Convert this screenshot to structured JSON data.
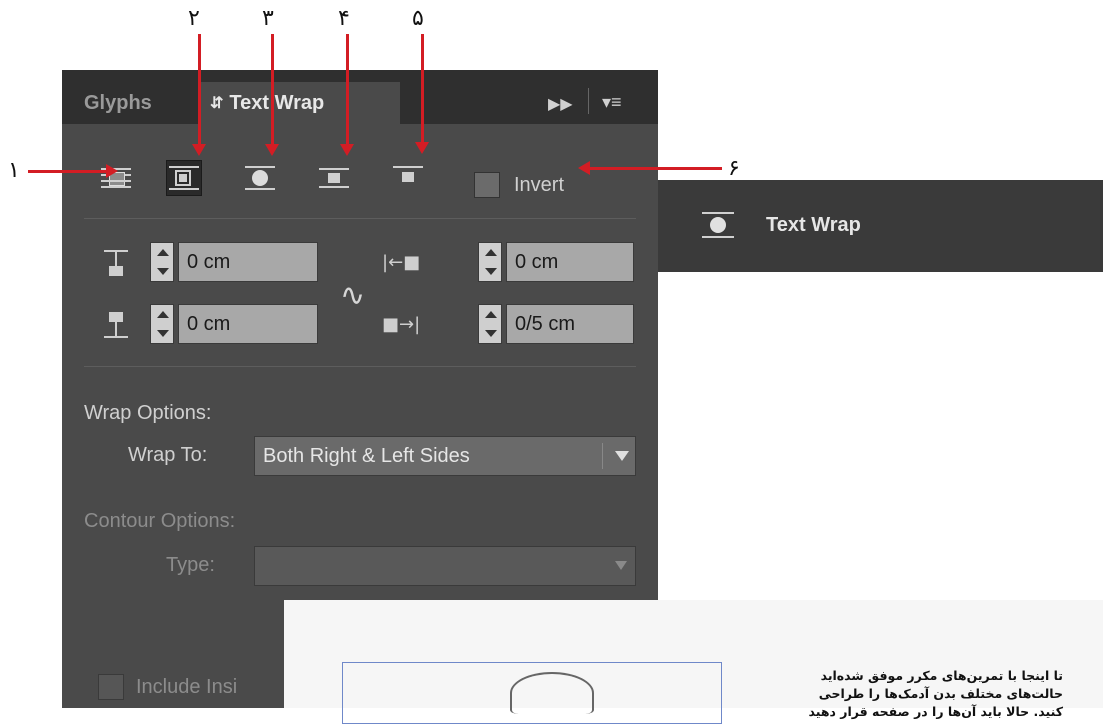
{
  "callouts": [
    "۱",
    "۲",
    "۳",
    "۴",
    "۵",
    "۶"
  ],
  "panel": {
    "tabs": [
      "Glyphs",
      "Text Wrap"
    ],
    "active_tab_icon": "up-down-chevron-icon",
    "tab_menu_icons": [
      "expand-arrows-icon",
      "panel-menu-icon"
    ],
    "wrap_buttons": [
      {
        "name": "no-text-wrap-icon"
      },
      {
        "name": "wrap-around-bounding-box-icon",
        "selected": true
      },
      {
        "name": "wrap-around-object-shape-icon"
      },
      {
        "name": "jump-object-icon"
      },
      {
        "name": "jump-to-next-column-icon"
      }
    ],
    "invert_label": "Invert",
    "offsets": {
      "top": "0 cm",
      "bottom": "0 cm",
      "left": "0 cm",
      "right": "0/5 cm"
    },
    "wrap_options_heading": "Wrap Options:",
    "wrap_to_label": "Wrap To:",
    "wrap_to_value": "Both Right & Left Sides",
    "contour_options_heading": "Contour Options:",
    "type_label": "Type:",
    "type_value": "",
    "include_inside_label": "Include Insi"
  },
  "menu_item": {
    "label": "Text Wrap",
    "icon": "text-wrap-icon"
  },
  "document_text": [
    "تا اینجا با تمرین‌های مکرر موفق شده‌اید",
    "حالت‌های مختلف بدن آدمک‌ها را طراحی",
    "کنید. حالا باید آن‌ها را در صفحه قرار دهید"
  ],
  "colors": {
    "panel_bg": "#4a4a4a",
    "tabbar_bg": "#2f2f2f",
    "arrow": "#d31d24",
    "field_bg": "#a8a8a8"
  }
}
